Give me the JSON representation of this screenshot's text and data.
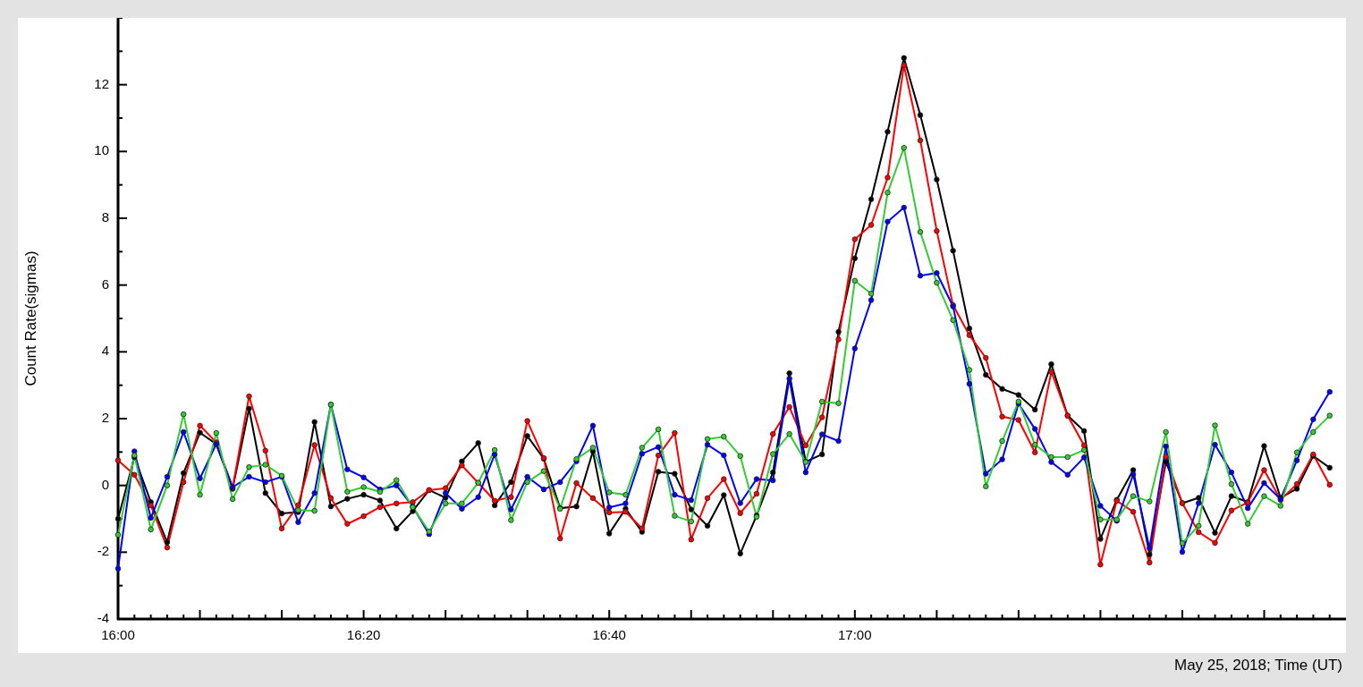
{
  "plot": {
    "chart_data": {
      "type": "line",
      "xlabel": "May 25, 2018; Time (UT)",
      "ylabel": "Count Rate(sigmas)",
      "x": [
        960,
        961.33,
        962.67,
        964,
        965.33,
        966.67,
        968,
        969.33,
        970.67,
        972,
        973.33,
        974.67,
        976,
        977.33,
        978.67,
        980,
        981.33,
        982.67,
        984,
        985.33,
        986.67,
        988,
        989.33,
        990.67,
        992,
        993.33,
        994.67,
        996,
        997.33,
        998.67,
        1000,
        1001.33,
        1002.67,
        1004,
        1005.33,
        1006.67,
        1008,
        1009.33,
        1010.67,
        1012,
        1013.33,
        1014.67,
        1016,
        1017.33,
        1018.67,
        1020,
        1021.33,
        1022.67,
        1024,
        1025.33,
        1026.67,
        1028,
        1029.33,
        1030.67,
        1032,
        1033.33,
        1034.67,
        1036,
        1037.33,
        1038.67,
        1040,
        1041.33,
        1042.67,
        1044,
        1045.33,
        1046.67,
        1048,
        1049.33,
        1050.67,
        1052,
        1053.33,
        1054.67,
        1056,
        1057.33,
        1058.67
      ],
      "xlim": [
        960,
        1060
      ],
      "ylim": [
        -4,
        14
      ],
      "xticks": [
        {
          "value": 960,
          "label": "16:00"
        },
        {
          "value": 980,
          "label": "16:20"
        },
        {
          "value": 1000,
          "label": "16:40"
        },
        {
          "value": 1020,
          "label": "17:00"
        }
      ],
      "yticks": [
        -4,
        -2,
        0,
        2,
        4,
        6,
        8,
        10,
        12
      ],
      "series": [
        {
          "color": "#000000",
          "marker": "circle",
          "values": [
            -1.0,
            0.85,
            -0.5,
            -1.7,
            0.37,
            1.58,
            1.24,
            -0.1,
            2.3,
            -0.23,
            -0.84,
            -0.8,
            1.9,
            -0.63,
            -0.4,
            -0.28,
            -0.45,
            -1.29,
            -0.77,
            -0.14,
            -0.37,
            0.72,
            1.27,
            -0.6,
            0.1,
            1.48,
            0.8,
            -0.68,
            -0.63,
            1.02,
            -1.44,
            -0.7,
            -1.39,
            0.41,
            0.35,
            -0.72,
            -1.21,
            -0.29,
            -2.04,
            -0.9,
            0.39,
            3.36,
            0.71,
            0.93,
            4.6,
            6.8,
            8.57,
            10.59,
            12.8,
            11.09,
            9.16,
            7.03,
            4.7,
            3.31,
            2.89,
            2.71,
            2.27,
            3.63,
            2.09,
            1.63,
            -1.6,
            -0.43,
            0.46,
            -2.07,
            0.7,
            -0.53,
            -0.37,
            -1.42,
            -0.32,
            -0.5,
            1.18,
            -0.37,
            -0.1,
            0.88,
            0.53
          ]
        },
        {
          "color": "#ff0000",
          "marker": "circle",
          "values": [
            0.75,
            0.32,
            -0.6,
            -1.86,
            0.1,
            1.79,
            1.29,
            -0.07,
            2.67,
            1.04,
            -1.29,
            -0.59,
            1.21,
            -0.38,
            -1.15,
            -0.92,
            -0.65,
            -0.54,
            -0.5,
            -0.14,
            -0.08,
            0.6,
            0.08,
            -0.46,
            -0.35,
            1.93,
            0.82,
            -1.59,
            0.07,
            -0.38,
            -0.81,
            -0.79,
            -1.29,
            0.9,
            1.57,
            -1.62,
            -0.38,
            0.19,
            -0.83,
            -0.25,
            1.54,
            2.35,
            1.2,
            2.04,
            4.37,
            7.37,
            7.8,
            9.22,
            12.58,
            10.33,
            7.62,
            5.4,
            4.5,
            3.82,
            2.06,
            1.96,
            0.99,
            3.4,
            2.09,
            1.2,
            -2.37,
            -0.46,
            -0.79,
            -2.31,
            0.86,
            -0.53,
            -1.4,
            -1.72,
            -0.75,
            -0.51,
            0.46,
            -0.43,
            0.04,
            0.93,
            0.02
          ]
        },
        {
          "color": "#0000ff",
          "marker": "circle",
          "values": [
            -2.49,
            1.02,
            -0.97,
            0.26,
            1.6,
            0.21,
            1.24,
            -0.05,
            0.26,
            0.1,
            0.26,
            -1.1,
            -0.23,
            2.42,
            0.48,
            0.24,
            -0.12,
            0,
            -0.63,
            -1.46,
            -0.23,
            -0.7,
            -0.35,
            0.93,
            -0.72,
            0.26,
            -0.12,
            0.1,
            0.72,
            1.79,
            -0.66,
            -0.54,
            0.95,
            1.15,
            -0.28,
            -0.44,
            1.22,
            0.9,
            -0.53,
            0.19,
            0.15,
            3.2,
            0.39,
            1.53,
            1.33,
            4.1,
            5.55,
            7.9,
            8.32,
            6.28,
            6.36,
            5.36,
            3.04,
            0.35,
            0.78,
            2.45,
            1.69,
            0.7,
            0.32,
            0.84,
            -0.61,
            -1.06,
            0.33,
            -1.88,
            1.17,
            -1.99,
            -0.53,
            1.22,
            0.39,
            -0.68,
            0.07,
            -0.41,
            0.75,
            1.98,
            2.8
          ]
        },
        {
          "color": "#33cc33",
          "marker": "circle",
          "values": [
            -1.48,
            0.9,
            -1.32,
            0,
            2.13,
            -0.28,
            1.57,
            -0.41,
            0.55,
            0.62,
            0.29,
            -0.74,
            -0.76,
            2.42,
            -0.19,
            -0.05,
            -0.19,
            0.16,
            -0.65,
            -1.38,
            -0.54,
            -0.54,
            0.08,
            1.06,
            -1.04,
            0.1,
            0.43,
            -0.7,
            0.79,
            1.13,
            -0.21,
            -0.28,
            1.13,
            1.68,
            -0.91,
            -1.08,
            1.39,
            1.46,
            0.88,
            -0.94,
            0.94,
            1.54,
            0.7,
            2.51,
            2.46,
            6.13,
            5.74,
            8.77,
            10.11,
            7.59,
            6.07,
            4.95,
            3.46,
            -0.03,
            1.33,
            2.51,
            1.22,
            0.85,
            0.85,
            1.06,
            -1.02,
            -1.02,
            -0.32,
            -0.48,
            1.6,
            -1.73,
            -1.21,
            1.8,
            0.04,
            -1.15,
            -0.32,
            -0.61,
            0.99,
            1.6,
            2.09
          ]
        }
      ]
    }
  }
}
